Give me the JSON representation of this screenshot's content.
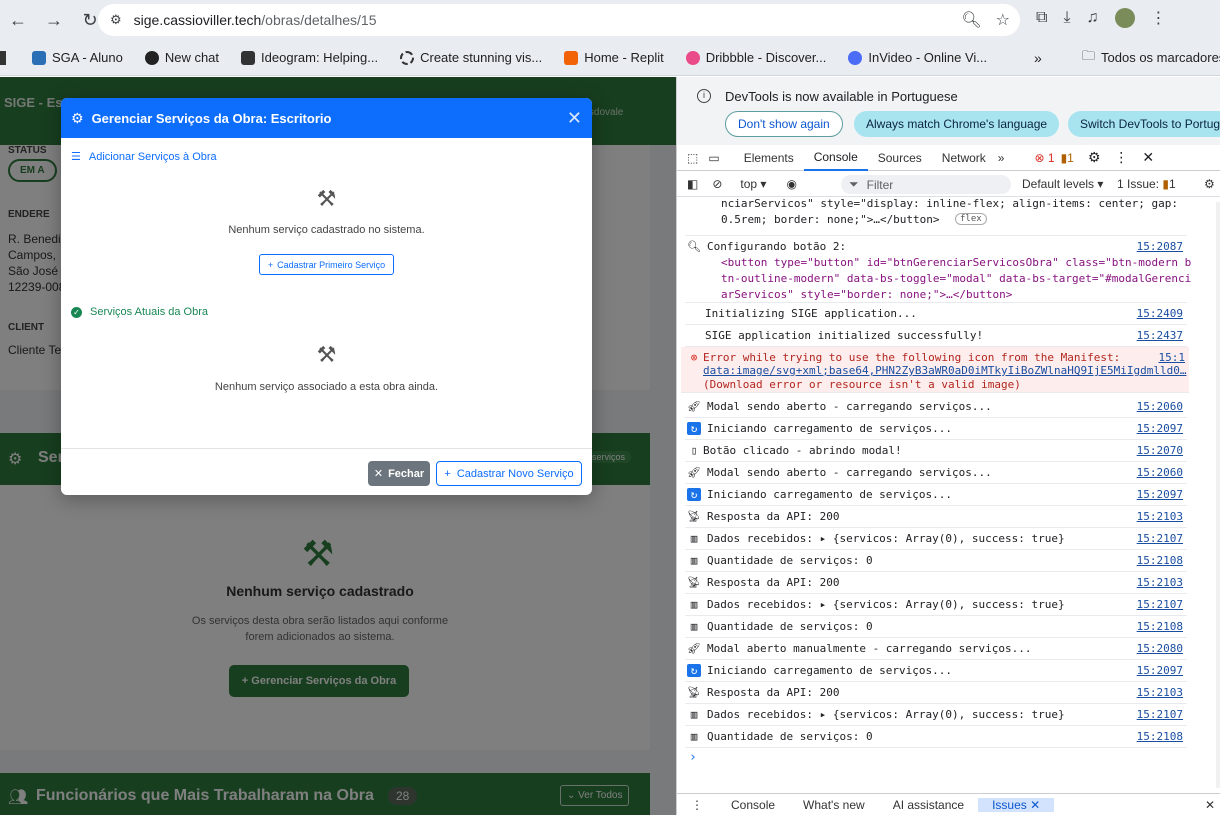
{
  "browser": {
    "url_host": "sige.cassioviller.tech",
    "url_path": "/obras/detalhes/15",
    "bookmarks": [
      "SGA - Aluno",
      "New chat",
      "Ideogram: Helping...",
      "Create stunning vis...",
      "Home - Replit",
      "Dribbble - Discover...",
      "InVideo - Online Vi..."
    ],
    "overflow_label": "»",
    "all_bookmarks": "Todos os marcadores"
  },
  "page": {
    "header_title": "SIGE - Est",
    "header_user": "arsdovale",
    "status_label": "STATUS",
    "status_badge": "EM A",
    "address_label": "ENDERE",
    "address_lines": [
      "R. Benedi",
      "Campos,",
      "São José",
      "12239-008"
    ],
    "client_label": "CLIENT",
    "client_value": "Cliente Te",
    "services_section_title": "Ser",
    "services_badge": "serviços",
    "empty_title": "Nenhum serviço cadastrado",
    "empty_desc": "Os serviços desta obra serão listados aqui conforme forem adicionados ao sistema.",
    "manage_button": "Gerenciar Serviços da Obra",
    "workers_title": "Funcionários que Mais Trabalharam na Obra",
    "workers_count": "28",
    "view_all": "Ver Todos"
  },
  "modal": {
    "title": "Gerenciar Serviços da Obra: Escritorio",
    "add_section": "Adicionar Serviços à Obra",
    "no_services_system": "Nenhum serviço cadastrado no sistema.",
    "register_first": "Cadastrar Primeiro Serviço",
    "current_section": "Serviços Atuais da Obra",
    "no_services_work": "Nenhum serviço associado a esta obra ainda.",
    "close_button": "Fechar",
    "new_service_button": "Cadastrar Novo Serviço"
  },
  "devtools": {
    "notice": "DevTools is now available in Portuguese",
    "btn_dont_show": "Don't show again",
    "btn_match": "Always match Chrome's language",
    "btn_switch": "Switch DevTools to Portug",
    "tabs": [
      "Elements",
      "Console",
      "Sources",
      "Network"
    ],
    "active_tab": "Console",
    "err_count": "1",
    "warn_count": "1",
    "context": "top",
    "filter_placeholder": "Filter",
    "levels": "Default levels",
    "issues": "1 Issue:",
    "issues_count": "1",
    "bottom_tabs": [
      "Console",
      "What's new",
      "AI assistance",
      "Issues"
    ],
    "rows": [
      {
        "msg": "nciarServicos\" style=\"display: inline-flex; align-items: center; gap:",
        "ts": ""
      },
      {
        "msg": "0.5rem; border: none;\">…</button>",
        "ts": ""
      },
      {
        "msg": "Configurando botão 2:",
        "ts": "15:2087"
      },
      {
        "msg": "<button type=\"button\" id=\"btnGerenciarServicosObra\" class=\"btn-modern b",
        "ts": ""
      },
      {
        "msg": "tn-outline-modern\" data-bs-toggle=\"modal\" data-bs-target=\"#modalGerenci",
        "ts": ""
      },
      {
        "msg": "arServicos\" style=\"border: none;\">…</button>",
        "ts": ""
      },
      {
        "msg": "Initializing SIGE application...",
        "ts": "15:2409"
      },
      {
        "msg": "SIGE application initialized successfully!",
        "ts": "15:2437"
      },
      {
        "msg": "Error while trying to use the following icon from the Manifest:",
        "ts": "15:1"
      },
      {
        "msg": "data:image/svg+xml;base64,PHN2ZyB3aWR0aD0iMTkyIiBoZWlnaHQ9IjE5MiIgdmlld0…",
        "ts": ""
      },
      {
        "msg": "(Download error or resource isn't a valid image)",
        "ts": ""
      },
      {
        "msg": "Modal sendo aberto - carregando serviços...",
        "ts": "15:2060"
      },
      {
        "msg": "Iniciando carregamento de serviços...",
        "ts": "15:2097"
      },
      {
        "msg": "Botão clicado - abrindo modal!",
        "ts": "15:2070"
      },
      {
        "msg": "Modal sendo aberto - carregando serviços...",
        "ts": "15:2060"
      },
      {
        "msg": "Iniciando carregamento de serviços...",
        "ts": "15:2097"
      },
      {
        "msg": "Resposta da API: 200",
        "ts": "15:2103"
      },
      {
        "msg": "Dados recebidos:  ▸ {servicos: Array(0), success: true}",
        "ts": "15:2107"
      },
      {
        "msg": "Quantidade de serviços: 0",
        "ts": "15:2108"
      },
      {
        "msg": "Resposta da API: 200",
        "ts": "15:2103"
      },
      {
        "msg": "Dados recebidos:  ▸ {servicos: Array(0), success: true}",
        "ts": "15:2107"
      },
      {
        "msg": "Quantidade de serviços: 0",
        "ts": "15:2108"
      },
      {
        "msg": "Modal aberto manualmente - carregando serviços...",
        "ts": "15:2080"
      },
      {
        "msg": "Iniciando carregamento de serviços...",
        "ts": "15:2097"
      },
      {
        "msg": "Resposta da API: 200",
        "ts": "15:2103"
      },
      {
        "msg": "Dados recebidos:  ▸ {servicos: Array(0), success: true}",
        "ts": "15:2107"
      },
      {
        "msg": "Quantidade de serviços: 0",
        "ts": "15:2108"
      }
    ],
    "flex_badge": "flex"
  }
}
